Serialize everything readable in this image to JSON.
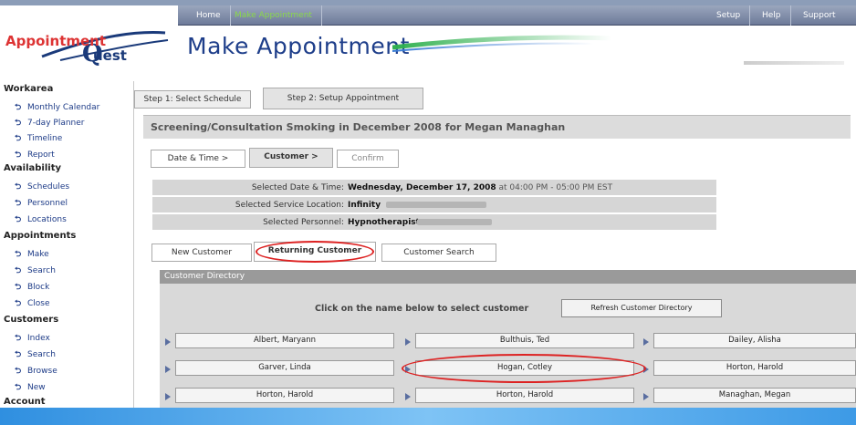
{
  "nav": {
    "home": "Home",
    "make_appointment": "Make Appointment",
    "setup": "Setup",
    "help": "Help",
    "support": "Support"
  },
  "logo": {
    "line1": "Appointment",
    "line2": "uest"
  },
  "page_title": "Make Appointment",
  "sidebar": {
    "workarea": {
      "title": "Workarea",
      "items": [
        "Monthly Calendar",
        "7-day Planner",
        "Timeline",
        "Report"
      ]
    },
    "availability": {
      "title": "Availability",
      "items": [
        "Schedules",
        "Personnel",
        "Locations"
      ]
    },
    "appointments": {
      "title": "Appointments",
      "items": [
        "Make",
        "Search",
        "Block",
        "Close"
      ]
    },
    "customers": {
      "title": "Customers",
      "items": [
        "Index",
        "Search",
        "Browse",
        "New"
      ]
    },
    "account": {
      "title": "Account"
    }
  },
  "steps": [
    "Step 1: Select Schedule",
    "Step 2: Setup Appointment"
  ],
  "header": "Screening/Consultation Smoking in December 2008 for Megan Managhan",
  "subtabs": [
    "Date & Time >",
    "Customer >",
    "Confirm"
  ],
  "info": {
    "date_label": "Selected Date & Time:",
    "date_value": "Wednesday, December 17, 2008",
    "date_suffix": " at 04:00 PM - 05:00 PM EST",
    "location_label": "Selected Service Location:",
    "location_value": "Infinity",
    "personnel_label": "Selected Personnel:",
    "personnel_value": "Hypnotherapist"
  },
  "custtabs": [
    "New Customer",
    "Returning Customer",
    "Customer Search"
  ],
  "directory": {
    "title": "Customer Directory",
    "instruction": "Click on the name below to select customer",
    "refresh": "Refresh Customer Directory",
    "rows": [
      [
        "Albert, Maryann",
        "Bulthuis, Ted",
        "Dailey, Alisha"
      ],
      [
        "Garver, Linda",
        "Hogan, Cotley",
        "Horton, Harold"
      ],
      [
        "Horton, Harold",
        "Horton, Harold",
        "Managhan, Megan"
      ]
    ]
  }
}
